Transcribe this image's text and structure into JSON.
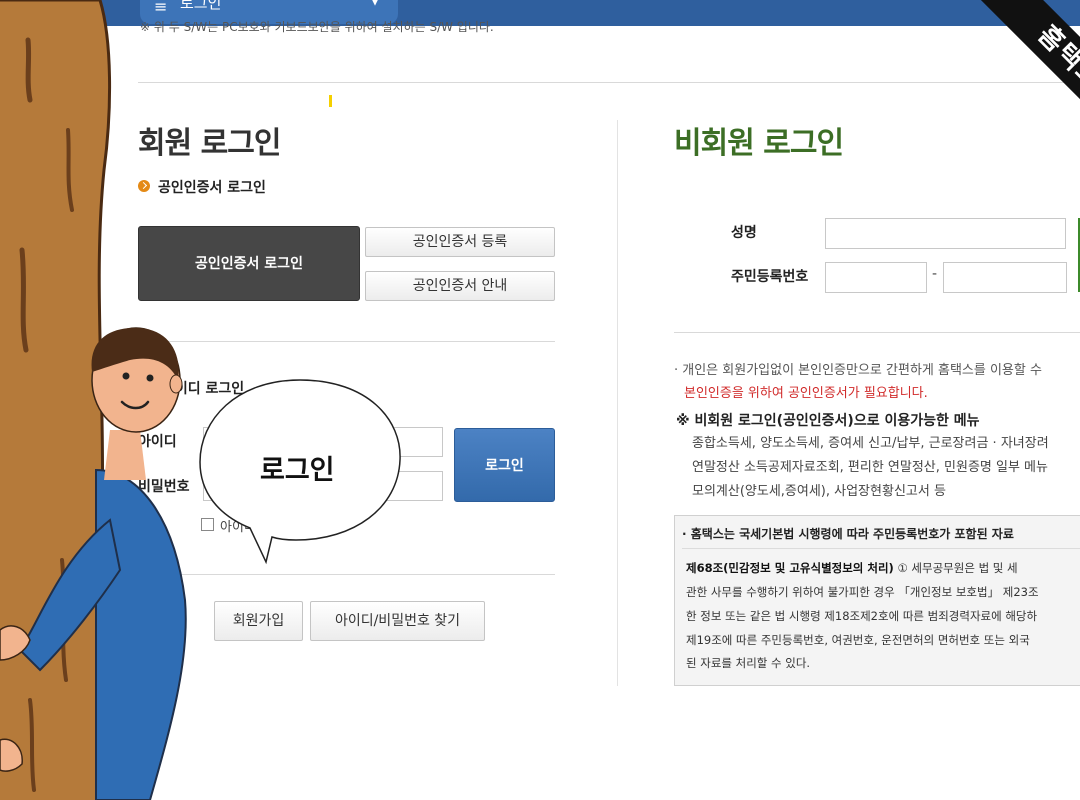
{
  "header": {
    "menu_label": "로그인",
    "notice": "※ 위 두 S/W는 PC보호와 키보드보안을 위하여 설치하는 S/W 입니다."
  },
  "ribbon": {
    "text": "홈택스"
  },
  "member": {
    "title": "회원 로그인",
    "cert_section": "공인인증서 로그인",
    "cert_login_button": "공인인증서 로그인",
    "cert_register_button": "공인인증서 등록",
    "cert_guide_button": "공인인증서 안내",
    "id_section": "아이디 로그인",
    "id_label": "아이디",
    "pw_label": "비밀번호",
    "login_button": "로그인",
    "save_id_label": "아이디 저장",
    "join_button": "회원가입",
    "find_button": "아이디/비밀번호 찾기"
  },
  "bubble": {
    "text": "로그인"
  },
  "nonmember": {
    "title": "비회원 로그인",
    "name_label": "성명",
    "rrn_label": "주민등록번호",
    "rrn_dash": "-",
    "info_line1": "· 개인은 회원가입없이 본인인증만으로 간편하게 홈택스를 이용할 수",
    "info_line2": "본인인증을 위하여 공인인증서가 필요합니다.",
    "menu_title": "※ 비회원 로그인(공인인증서)으로 이용가능한 메뉴",
    "menu_lines": [
      "종합소득세, 양도소득세, 증여세 신고/납부, 근로장려금 · 자녀장려",
      "연말정산 소득공제자료조회, 편리한 연말정산, 민원증명 일부 메뉴",
      "모의계산(양도세,증여세), 사업장현황신고서 등"
    ],
    "notice_title": "· 홈택스는 국세기본법 시행령에 따라 주민등록번호가 포함된 자료",
    "notice_bold": "제68조(민감정보 및 고유식별정보의 처리)",
    "notice_lines": [
      " ① 세무공무원은 법 및 세",
      "관한 사무를 수행하기 위하여 불가피한 경우 「개인정보 보호법」 제23조",
      "한 정보 또는 같은 법 시행령 제18조제2호에 따른 범죄경력자료에 해당하",
      "제19조에 따른 주민등록번호, 여권번호, 운전면허의 면허번호 또는 외국",
      "된 자료를 처리할 수 있다."
    ]
  },
  "colors": {
    "topbar": "#2f5f9e",
    "nonmember_title": "#3c6e25",
    "login_button": "#3d74b8",
    "cert_button": "#474747",
    "warning_text": "#d12b2b",
    "shirt": "#2f6db4",
    "tree": "#b57a3a"
  }
}
